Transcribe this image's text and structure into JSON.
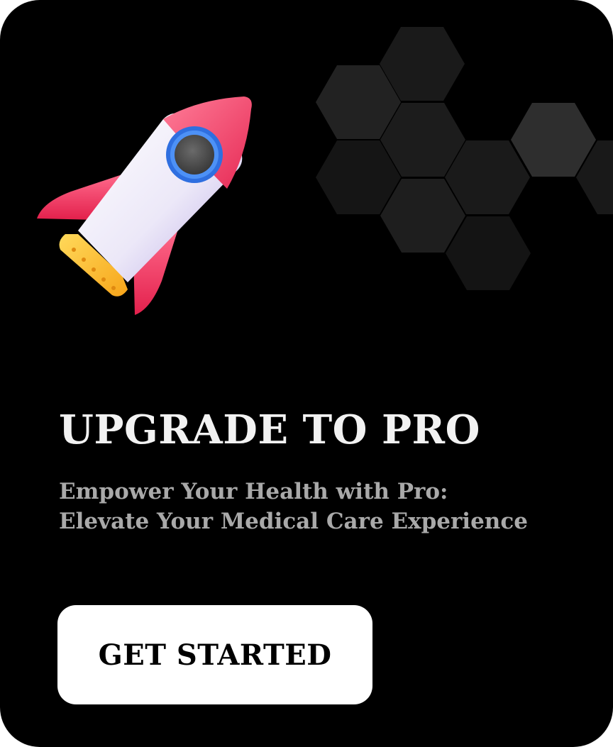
{
  "promo": {
    "title": "UPGRADE TO PRO",
    "subtitle_line1": "Empower Your Health with Pro:",
    "subtitle_line2": "Elevate Your Medical Care Experience",
    "cta_label": "GET STARTED"
  },
  "icons": {
    "hero": "rocket-icon",
    "decoration": "hexagon-pattern"
  },
  "colors": {
    "background": "#000000",
    "title": "#f2f2f2",
    "subtitle": "#a9a9a9",
    "button_bg": "#ffffff",
    "button_text": "#000000",
    "rocket_red": "#f0406a",
    "rocket_body": "#e6e2f5",
    "rocket_window_ring": "#2f6fe0",
    "rocket_exhaust": "#ffc22e"
  }
}
